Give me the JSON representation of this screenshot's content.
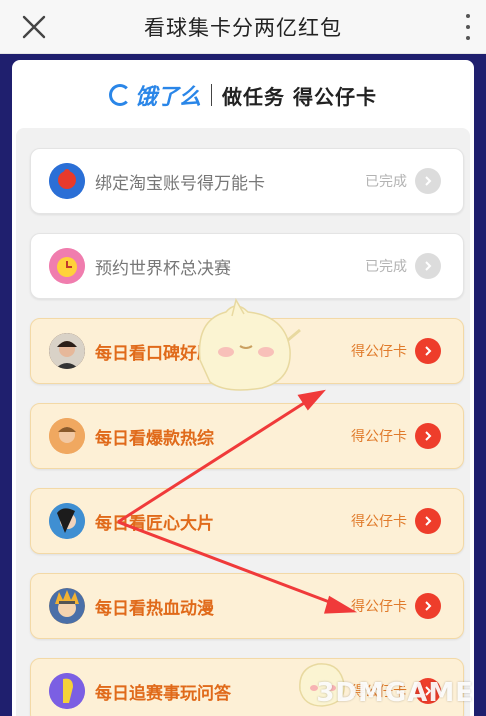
{
  "header": {
    "title": "看球集卡分两亿红包"
  },
  "brand": {
    "name": "饿了么",
    "tagline": "做任务 得公仔卡"
  },
  "tasks": [
    {
      "label": "绑定淘宝账号得万能卡",
      "status": "已完成",
      "state": "done",
      "icon": "taobao-icon"
    },
    {
      "label": "预约世界杯总决赛",
      "status": "已完成",
      "state": "done",
      "icon": "alarm-clock-icon"
    },
    {
      "label": "每日看口碑好剧",
      "status": "得公仔卡",
      "state": "todo",
      "icon": "avatar-actor-icon"
    },
    {
      "label": "每日看爆款热综",
      "status": "得公仔卡",
      "state": "todo",
      "icon": "avatar-variety-icon"
    },
    {
      "label": "每日看匠心大片",
      "status": "得公仔卡",
      "state": "todo",
      "icon": "avatar-movie-icon"
    },
    {
      "label": "每日看热血动漫",
      "status": "得公仔卡",
      "state": "todo",
      "icon": "avatar-anime-icon"
    },
    {
      "label": "每日追赛事玩问答",
      "status": "得公仔卡",
      "state": "todo",
      "icon": "avatar-sports-icon"
    }
  ],
  "watermark": "3DMGAME",
  "colors": {
    "accent": "#ee3d2b",
    "brand": "#2a86e8",
    "todo_bg": "#fdf0d6",
    "frame": "#1f1f6e"
  }
}
